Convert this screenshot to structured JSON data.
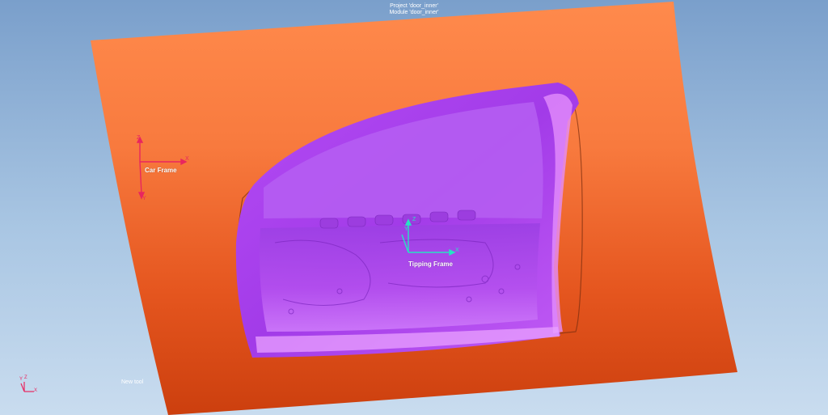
{
  "viewport": {
    "project_title": "Project 'door_inner'",
    "module_title": "Module 'door_inner'",
    "status_text": "New tool"
  },
  "frames": {
    "car_frame": {
      "label": "Car Frame",
      "axis_x": "X",
      "axis_y": "Y",
      "axis_z": "Z",
      "color": "#e8265f"
    },
    "tipping_frame": {
      "label": "Tipping Frame",
      "axis_x": "X",
      "axis_y": "Y",
      "axis_z": "Z",
      "color": "#27e2c4"
    },
    "view_triad": {
      "axis_x": "X",
      "axis_y": "Y",
      "axis_z": "Z",
      "color": "#e8265f"
    }
  },
  "colors": {
    "sky_top": "#7a9fcb",
    "sky_bottom": "#c9dcef",
    "binder_surface": "#f2753a",
    "binder_shadow": "#c63a10",
    "part_surface": "#b43cf0",
    "part_highlight": "#e08cff"
  }
}
